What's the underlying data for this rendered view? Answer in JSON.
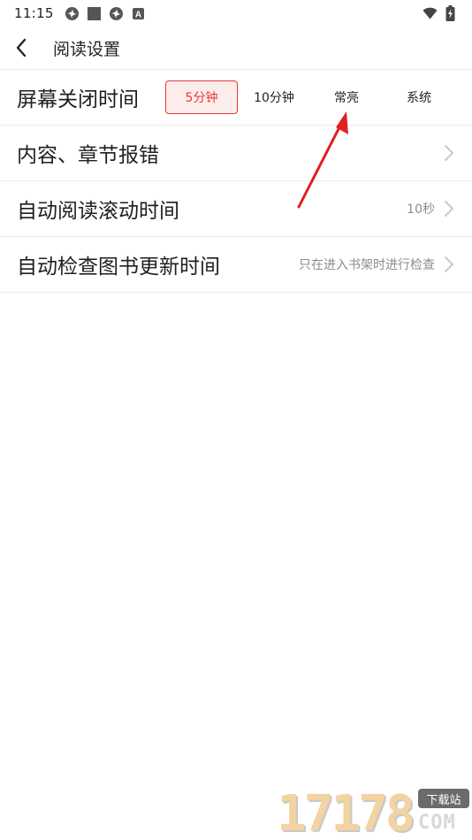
{
  "status_bar": {
    "time": "11:15",
    "left_icons": [
      "sync-icon",
      "square-icon",
      "sync-icon",
      "keyboard-a-icon"
    ],
    "right_icons": [
      "wifi-icon",
      "battery-charging-icon"
    ],
    "a_badge": "A"
  },
  "header": {
    "title": "阅读设置"
  },
  "settings": {
    "screen_off": {
      "label": "屏幕关闭时间",
      "options": [
        "5分钟",
        "10分钟",
        "常亮",
        "系统"
      ],
      "selected_index": 0
    },
    "report_error": {
      "label": "内容、章节报错"
    },
    "auto_scroll": {
      "label": "自动阅读滚动时间",
      "value": "10秒"
    },
    "auto_check": {
      "label": "自动检查图书更新时间",
      "value": "只在进入书架时进行检查"
    }
  },
  "watermark": {
    "number": "17178",
    "badge": "下载站",
    "com": "COM"
  },
  "colors": {
    "accent": "#e53935",
    "accent_bg": "#fdecec",
    "divider": "#ececec",
    "secondary_text": "#8c8c8c"
  }
}
